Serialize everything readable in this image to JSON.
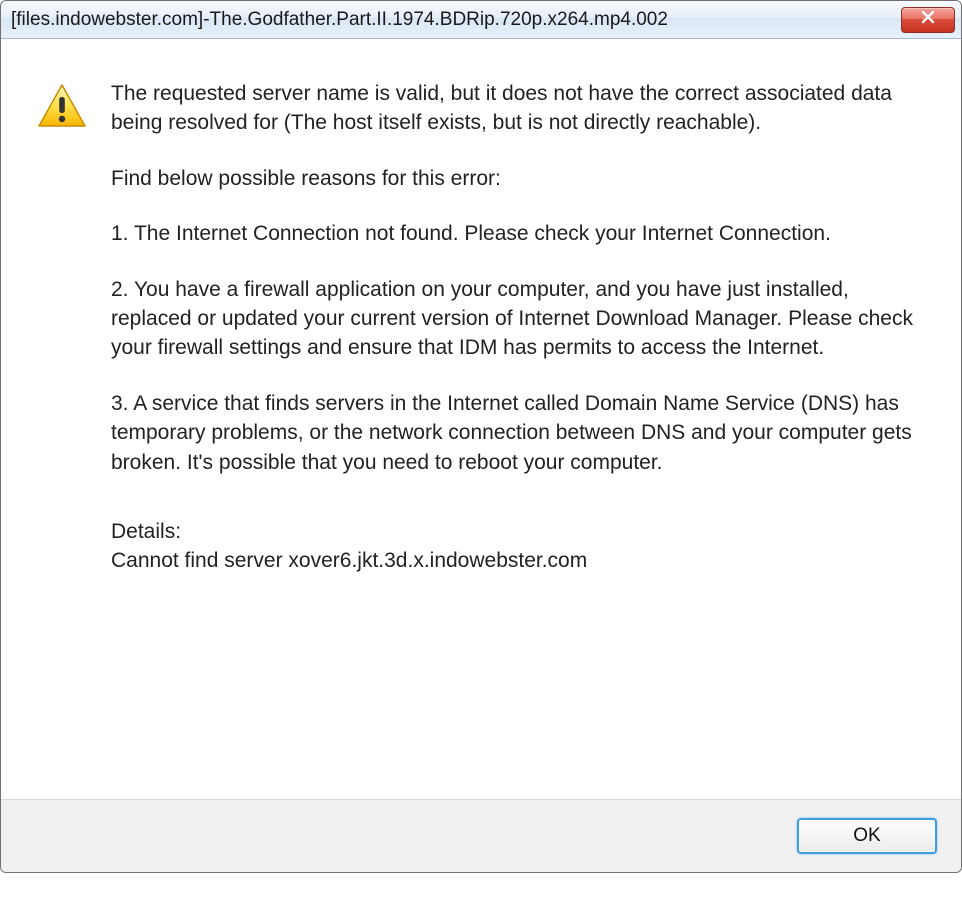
{
  "titlebar": {
    "text": "[files.indowebster.com]-The.Godfather.Part.II.1974.BDRip.720p.x264.mp4.002"
  },
  "message": {
    "intro": "The requested server name is valid, but it does not have the correct associated data being resolved for (The host itself exists, but is not directly reachable).",
    "reasons_header": "Find below possible reasons for this error:",
    "reason1": "1. The Internet Connection not found. Please check your Internet Connection.",
    "reason2": "2. You have a firewall application on your computer, and you have just installed, replaced or updated your current version of Internet Download Manager. Please check your firewall settings and ensure that IDM has permits to access the Internet.",
    "reason3": "3. A service that finds servers in the Internet called Domain Name Service (DNS) has temporary problems, or the network connection between DNS and your computer gets broken. It's possible that you need to reboot your computer.",
    "details_label": "Details:",
    "details_value": "Cannot find server xover6.jkt.3d.x.indowebster.com"
  },
  "buttons": {
    "ok": "OK"
  }
}
